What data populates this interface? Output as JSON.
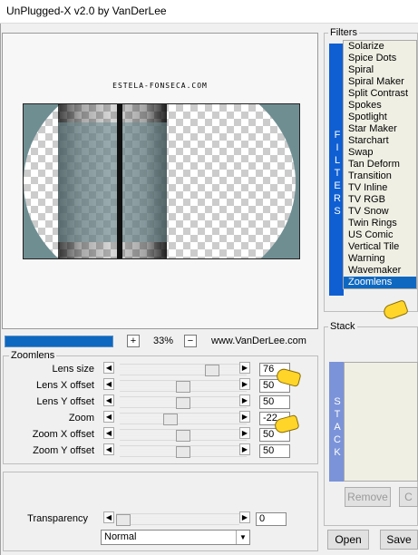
{
  "window": {
    "title": "UnPlugged-X v2.0 by VanDerLee"
  },
  "preview": {
    "watermark": "ESTELA-FONSECA.COM"
  },
  "zoom": {
    "minus": "+",
    "value": "33%",
    "plus": "−",
    "site": "www.VanDerLee.com"
  },
  "params": {
    "group_label": "Zoomlens",
    "rows": [
      {
        "label": "Lens size",
        "value": "76",
        "slider": 0.76
      },
      {
        "label": "Lens X offset",
        "value": "50",
        "slider": 0.5
      },
      {
        "label": "Lens Y offset",
        "value": "50",
        "slider": 0.5
      },
      {
        "label": "Zoom",
        "value": "-22",
        "slider": 0.39
      },
      {
        "label": "Zoom X offset",
        "value": "50",
        "slider": 0.5
      },
      {
        "label": "Zoom Y offset",
        "value": "50",
        "slider": 0.5
      }
    ]
  },
  "transparency": {
    "label": "Transparency",
    "value": "0",
    "slider": 0.0
  },
  "blend": {
    "selected": "Normal"
  },
  "filters": {
    "label": "Filters",
    "side": "FILTERS",
    "items": [
      "Solarize",
      "Spice Dots",
      "Spiral",
      "Spiral Maker",
      "Split Contrast",
      "Spokes",
      "Spotlight",
      "Star Maker",
      "Starchart",
      "Swap",
      "Tan Deform",
      "Transition",
      "TV Inline",
      "TV RGB",
      "TV Snow",
      "Twin Rings",
      "US Comic",
      "Vertical Tile",
      "Warning",
      "Wavemaker",
      "Zoomlens"
    ],
    "selected": "Zoomlens"
  },
  "stack": {
    "label": "Stack",
    "side": "STACK",
    "remove": "Remove",
    "c": "C"
  },
  "buttons": {
    "open": "Open",
    "save": "Save"
  },
  "colors": {
    "accent": "#0f68c0",
    "teal": "#6f8e92"
  }
}
